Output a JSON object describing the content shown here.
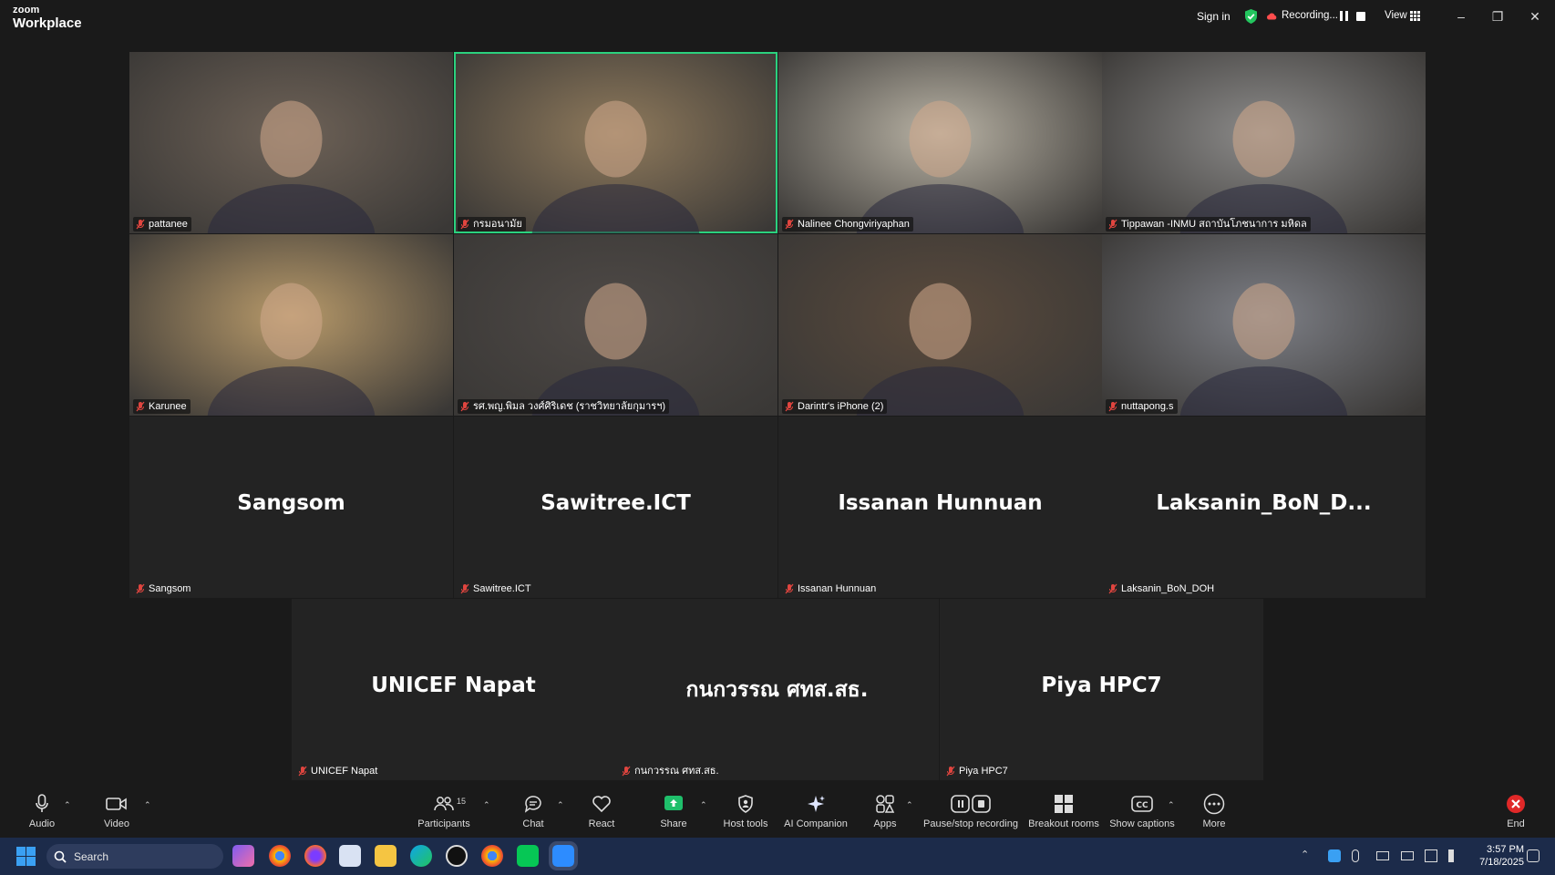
{
  "app": {
    "brand_small": "zoom",
    "brand_name": "Workplace"
  },
  "titlebar": {
    "sign_in": "Sign in",
    "recording_label": "Recording...",
    "view_label": "View",
    "minimize": "–",
    "restore": "❐",
    "close": "✕"
  },
  "tiles": [
    {
      "name": "pattanee",
      "kind": "video",
      "color": "#6e6257"
    },
    {
      "name": "กรมอนามัย",
      "kind": "video",
      "color": "#8f7a5c",
      "active": true
    },
    {
      "name": "Nalinee Chongviriyaphan",
      "kind": "video",
      "color": "#b9b3a5"
    },
    {
      "name": "Tippawan -INMU สถาบันโภชนาการ มหิดล",
      "kind": "video",
      "color": "#8c8b8a"
    },
    {
      "name": "Karunee",
      "kind": "video",
      "color": "#b89a6a"
    },
    {
      "name": "รศ.พญ.พิมล วงศ์ศิริเดช (ราชวิทยาลัยกุมารฯ)",
      "kind": "video",
      "color": "#4f4a47"
    },
    {
      "name": "Darintr's iPhone (2)",
      "kind": "video",
      "color": "#5a4a3c"
    },
    {
      "name": "nuttapong.s",
      "kind": "video",
      "color": "#7d7f86"
    },
    {
      "name": "Sangsom",
      "kind": "avatar",
      "display": "Sangsom"
    },
    {
      "name": "Sawitree.ICT",
      "kind": "avatar",
      "display": "Sawitree.ICT"
    },
    {
      "name": "Issanan Hunnuan",
      "kind": "avatar",
      "display": "Issanan Hunnuan"
    },
    {
      "name": "Laksanin_BoN_DOH",
      "kind": "avatar",
      "display": "Laksanin_BoN_D..."
    },
    {
      "name": "UNICEF Napat",
      "kind": "avatar",
      "display": "UNICEF Napat"
    },
    {
      "name": "กนกวรรณ ศทส.สธ.",
      "kind": "avatar",
      "display": "กนกวรรณ ศทส.สธ."
    },
    {
      "name": "Piya HPC7",
      "kind": "avatar",
      "display": "Piya HPC7"
    }
  ],
  "toolbar": {
    "audio": "Audio",
    "video": "Video",
    "participants": "Participants",
    "participants_count": "15",
    "chat": "Chat",
    "react": "React",
    "share": "Share",
    "host_tools": "Host tools",
    "ai_companion": "AI Companion",
    "apps": "Apps",
    "pause_stop_recording": "Pause/stop recording",
    "breakout_rooms": "Breakout rooms",
    "show_captions": "Show captions",
    "more": "More",
    "end": "End"
  },
  "taskbar": {
    "search_placeholder": "Search",
    "time": "3:57 PM",
    "date": "7/18/2025"
  },
  "colors": {
    "accent_green": "#2bd17e",
    "share_green": "#1fbf6b",
    "end_red": "#e02828",
    "mute_red": "#e0453f"
  }
}
